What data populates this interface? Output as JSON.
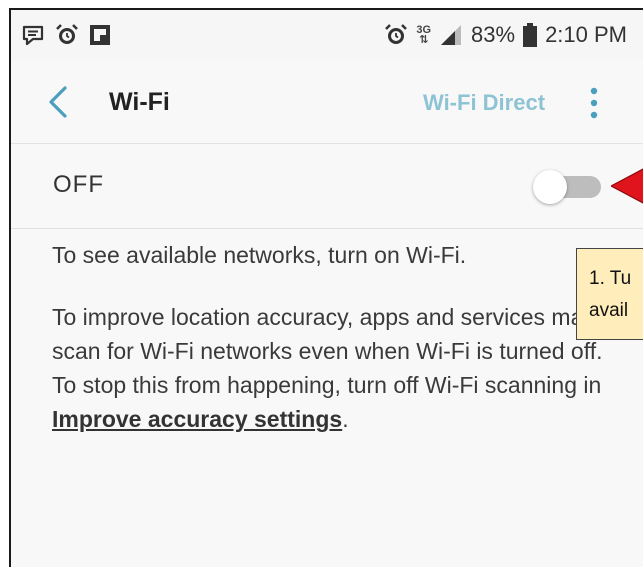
{
  "status_bar": {
    "left_icons": [
      "message-icon",
      "alarm-icon",
      "flipboard-icon"
    ],
    "network": "3G",
    "battery_percent": "83%",
    "time": "2:10 PM"
  },
  "header": {
    "title": "Wi-Fi",
    "wifi_direct_label": "Wi-Fi Direct",
    "back_icon": "chevron-left-icon",
    "more_icon": "more-vertical-icon"
  },
  "wifi_toggle": {
    "state_label": "OFF",
    "enabled": false
  },
  "content": {
    "info_line": "To see available networks, turn on Wi-Fi.",
    "scan_text": "To improve location accuracy, apps and services may scan for Wi-Fi networks even when Wi-Fi is turned off. To stop this from happening, turn off Wi-Fi scanning in",
    "scan_link": "Improve accuracy settings",
    "scan_end": "."
  },
  "annotation": {
    "callout_line1": "1. Tu",
    "callout_line2": "avail",
    "arrow_color": "#e0141c",
    "callout_bg": "#ffeebb"
  },
  "colors": {
    "accent": "#4a9fbf",
    "wifi_direct": "#8ec3d4",
    "toggle_track": "#bdbdbd"
  }
}
